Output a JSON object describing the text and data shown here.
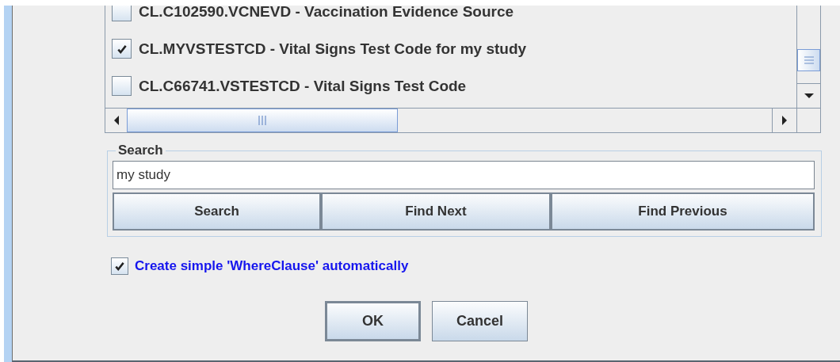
{
  "list": {
    "items": [
      {
        "label": "CL.C102590.VCNEVD - Vaccination Evidence Source",
        "checked": false
      },
      {
        "label": "CL.MYVSTESTCD - Vital Signs Test Code for my study",
        "checked": true
      },
      {
        "label": "CL.C66741.VSTESTCD - Vital Signs Test Code",
        "checked": false
      }
    ]
  },
  "search": {
    "title": "Search",
    "value": "my study",
    "buttons": [
      "Search",
      "Find Next",
      "Find Previous"
    ]
  },
  "where_clause": {
    "label": "Create simple 'WhereClause' automatically",
    "checked": true
  },
  "buttons": [
    {
      "label": "OK",
      "default": true
    },
    {
      "label": "Cancel",
      "default": false
    }
  ]
}
